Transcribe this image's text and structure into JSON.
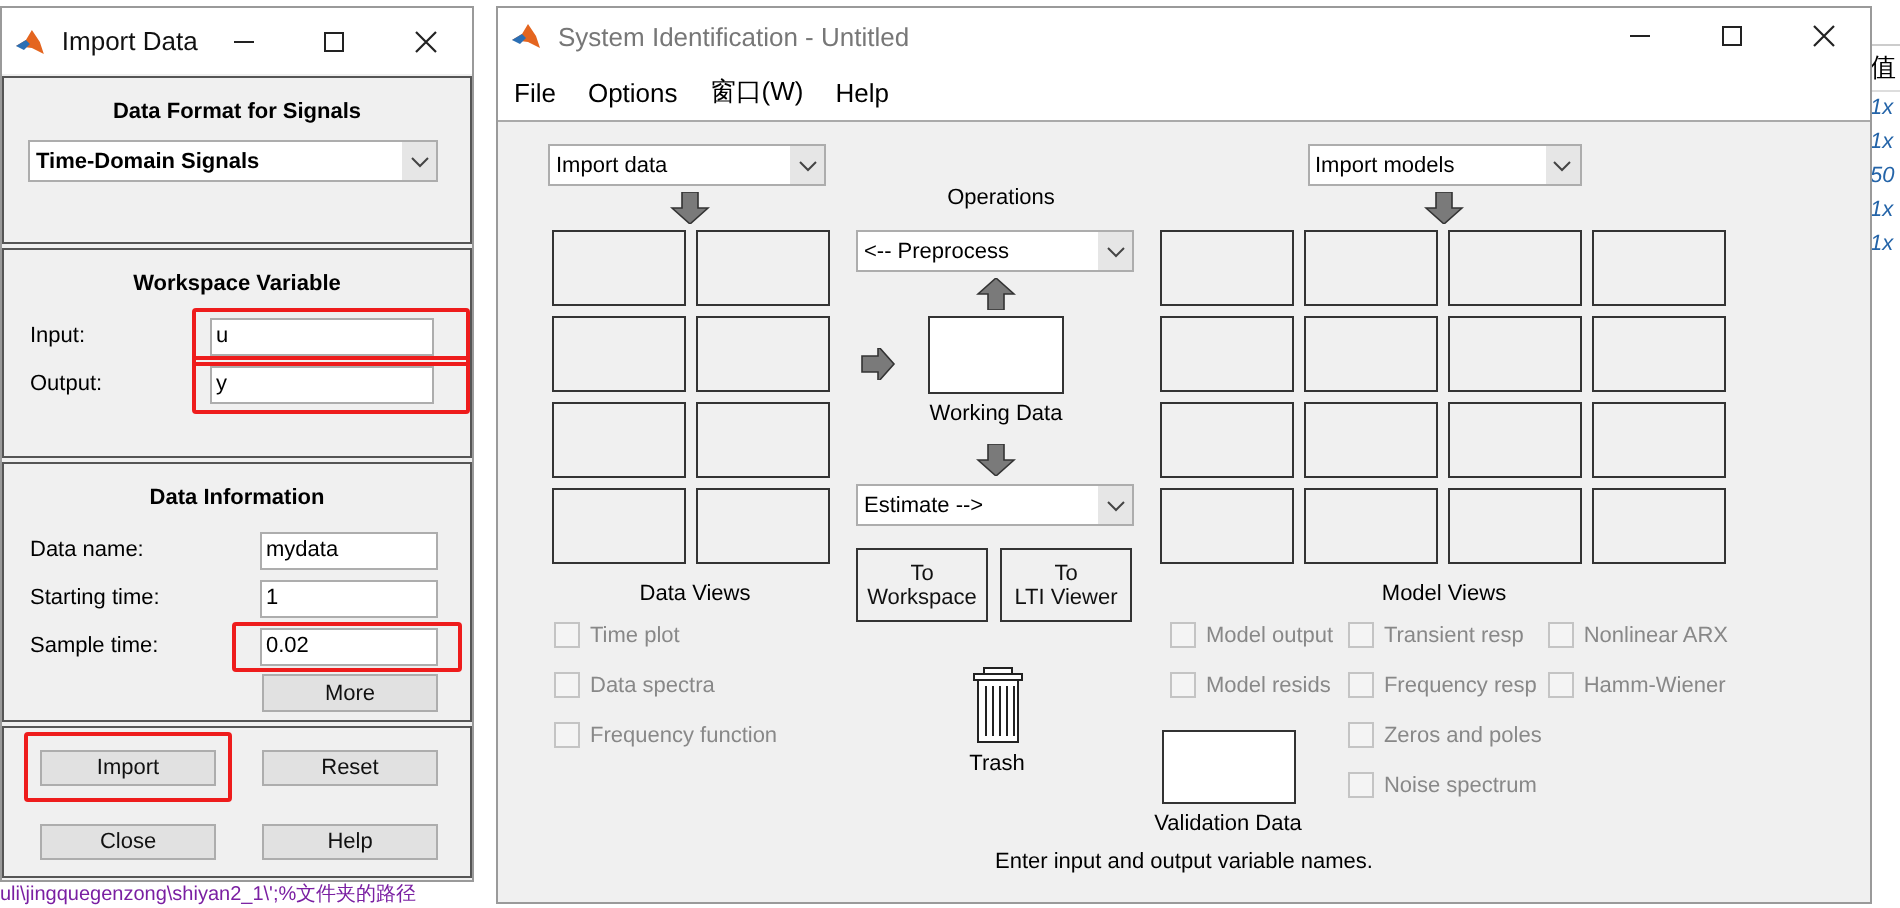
{
  "background": {
    "editor_line": "uli\\jingquegenzong\\shiyan2_1\\';%文件夹的路径",
    "workspace": {
      "header": "值",
      "values": [
        "1x",
        "1x",
        "50",
        "1x",
        "1x"
      ]
    }
  },
  "import_dialog": {
    "title": "Import Data",
    "format_panel": {
      "title": "Data Format for Signals",
      "format": "Time-Domain Signals"
    },
    "workspace_panel": {
      "title": "Workspace Variable",
      "fields": [
        {
          "label": "Input:",
          "value": "u",
          "highlighted": true
        },
        {
          "label": "Output:",
          "value": "y",
          "highlighted": true
        }
      ]
    },
    "info_panel": {
      "title": "Data Information",
      "fields": [
        {
          "label": "Data name:",
          "value": "mydata",
          "highlighted": false
        },
        {
          "label": "Starting time:",
          "value": "1",
          "highlighted": false
        },
        {
          "label": "Sample time:",
          "value": "0.02",
          "highlighted": true
        }
      ],
      "more_button": "More"
    },
    "buttons": [
      {
        "label": "Import",
        "highlighted": true
      },
      {
        "label": "Reset",
        "highlighted": false
      },
      {
        "label": "Close",
        "highlighted": false
      },
      {
        "label": "Help",
        "highlighted": false
      }
    ]
  },
  "sysid": {
    "title": "System Identification - Untitled",
    "menu": [
      "File",
      "Options",
      "窗口(W)",
      "Help"
    ],
    "import_data": "Import data",
    "import_models": "Import models",
    "operations_label": "Operations",
    "preprocess": "<-- Preprocess",
    "working_data": "Working Data",
    "estimate": "Estimate -->",
    "export_buttons": [
      {
        "line1": "To",
        "line2": "Workspace"
      },
      {
        "line1": "To",
        "line2": "LTI Viewer"
      }
    ],
    "trash": "Trash",
    "validation_data": "Validation Data",
    "data_views": {
      "title": "Data Views",
      "items": [
        {
          "label": "Time plot",
          "checked": false,
          "disabled": true
        },
        {
          "label": "Data spectra",
          "checked": false,
          "disabled": true
        },
        {
          "label": "Frequency function",
          "checked": false,
          "disabled": true
        }
      ]
    },
    "model_views": {
      "title": "Model Views",
      "columns": [
        [
          {
            "label": "Model output",
            "checked": false,
            "disabled": true
          },
          {
            "label": "Model resids",
            "checked": false,
            "disabled": true
          }
        ],
        [
          {
            "label": "Transient resp",
            "checked": false,
            "disabled": true
          },
          {
            "label": "Frequency resp",
            "checked": false,
            "disabled": true
          },
          {
            "label": "Zeros and poles",
            "checked": false,
            "disabled": true
          },
          {
            "label": "Noise spectrum",
            "checked": false,
            "disabled": true
          }
        ],
        [
          {
            "label": "Nonlinear ARX",
            "checked": false,
            "disabled": true
          },
          {
            "label": "Hamm-Wiener",
            "checked": false,
            "disabled": true
          }
        ]
      ]
    },
    "status": "Enter input and output variable names."
  }
}
